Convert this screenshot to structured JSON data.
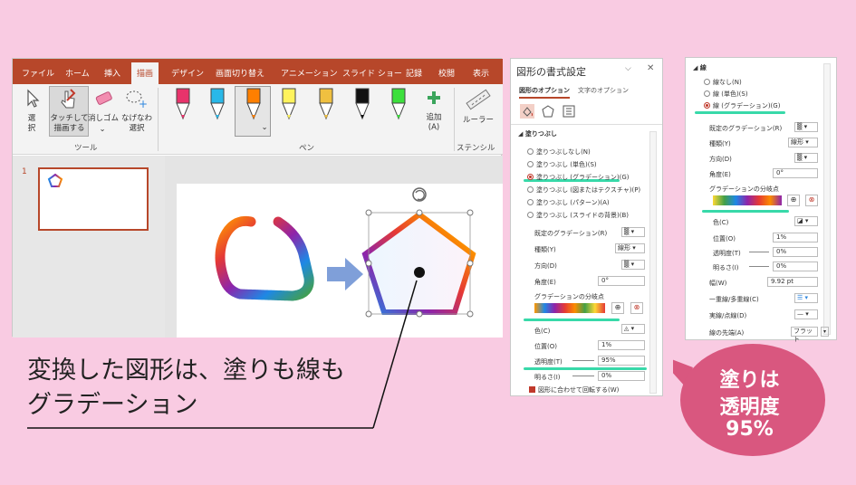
{
  "ribbon": {
    "tabs": [
      "ファイル",
      "ホーム",
      "挿入",
      "描画",
      "デザイン",
      "画面切り替え",
      "アニメーション",
      "スライド ショー",
      "記録",
      "校閲",
      "表示"
    ],
    "tools": {
      "select": "選\n択",
      "touch_draw": "タッチして\n描画する",
      "eraser": "消しゴム",
      "lasso": "なげなわ\n選択"
    },
    "group_tools": "ツール",
    "group_pens": "ペン",
    "add_pen": "追加\n(A)",
    "ruler": "ルーラー",
    "group_stencil": "ステンシル",
    "pen_colors": [
      "#e8336b",
      "#29b8e8",
      "#ff7f00",
      "#fff35c",
      "#f0c040",
      "#111111",
      "#3ce03c"
    ]
  },
  "slide_number": "1",
  "panel1": {
    "title": "図形の書式設定",
    "tab_shape": "図形のオプション",
    "tab_text": "文字のオプション",
    "section_fill": "塗りつぶし",
    "fill_options": [
      "塗りつぶしなし(N)",
      "塗りつぶし (単色)(S)",
      "塗りつぶし (グラデーション)(G)",
      "塗りつぶし (図またはテクスチャ)(P)",
      "塗りつぶし (パターン)(A)",
      "塗りつぶし (スライドの背景)(B)"
    ],
    "fill_selected_index": 2,
    "preset_label": "既定のグラデーション(R)",
    "type_label": "種類(Y)",
    "type_value": "線形",
    "direction_label": "方向(D)",
    "angle_label": "角度(E)",
    "angle_value": "0°",
    "stops_label": "グラデーションの分岐点",
    "color_label": "色(C)",
    "position_label": "位置(O)",
    "position_value": "1%",
    "transparency_label": "透明度(T)",
    "transparency_value": "95%",
    "brightness_label": "明るさ(I)",
    "brightness_value": "0%",
    "rotate_label": "図形に合わせて回転する(W)"
  },
  "panel2": {
    "section_line": "線",
    "line_options": [
      "線なし(N)",
      "線 (単色)(S)",
      "線 (グラデーション)(G)"
    ],
    "line_selected_index": 2,
    "preset_label": "既定のグラデーション(R)",
    "type_label": "種類(Y)",
    "type_value": "線形",
    "direction_label": "方向(D)",
    "angle_label": "角度(E)",
    "angle_value": "0°",
    "stops_label": "グラデーションの分岐点",
    "color_label": "色(C)",
    "position_label": "位置(O)",
    "position_value": "1%",
    "transparency_label": "透明度(T)",
    "transparency_value": "0%",
    "brightness_label": "明るさ(I)",
    "brightness_value": "0%",
    "width_label": "幅(W)",
    "width_value": "9.92 pt",
    "compound_label": "一重線/多重線(C)",
    "dash_label": "実線/点線(D)",
    "cap_label": "線の先端(A)",
    "cap_value": "フラット"
  },
  "caption": {
    "line1": "変換した図形は、塗りも線も",
    "line2": "グラデーション"
  },
  "bubble": {
    "line1": "塗りは",
    "line2": "透明度",
    "line3": "95%"
  },
  "colors": {
    "accent": "#b7472a",
    "bubble": "#d9577f",
    "highlight": "#38d9a9"
  }
}
